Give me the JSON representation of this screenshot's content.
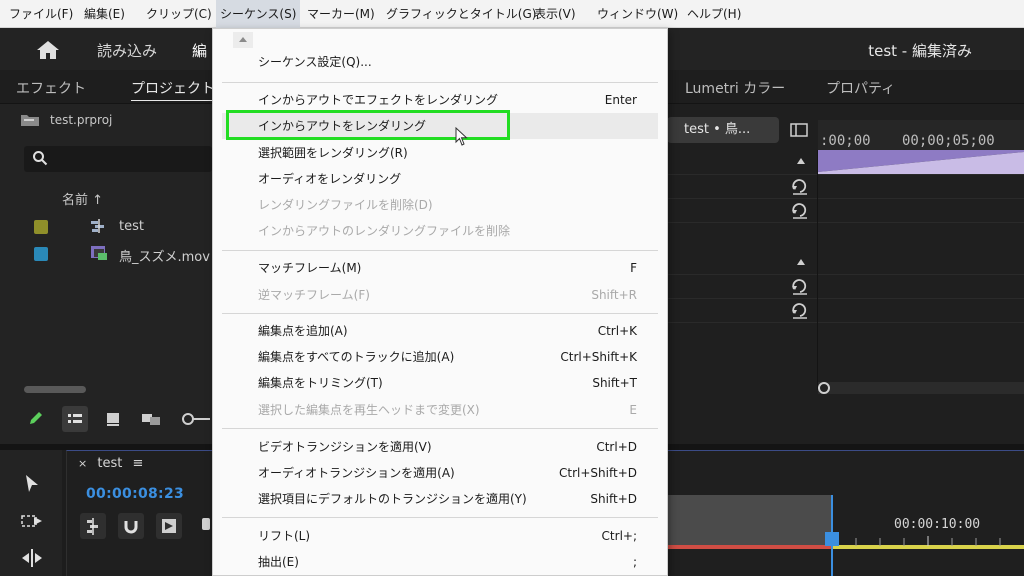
{
  "menubar": {
    "items": [
      "ファイル(F)",
      "編集(E)",
      "クリップ(C)",
      "シーケンス(S)",
      "マーカー(M)",
      "グラフィックとタイトル(G)",
      "表示(V)",
      "ウィンドウ(W)",
      "ヘルプ(H)"
    ],
    "active_index": 3
  },
  "workspace": {
    "tabs": [
      "読み込み",
      "編"
    ],
    "title": "test - 編集済み"
  },
  "panel_tabs": {
    "left": [
      "エフェクト",
      "プロジェクト"
    ],
    "right": [
      "Lumetri カラー",
      "プロパティ"
    ]
  },
  "project": {
    "file_name": "test.prproj",
    "column_name": "名前",
    "items": [
      {
        "label": "test",
        "swatch": "#8f8f2a",
        "icon": "sequence-icon"
      },
      {
        "label": "鳥_スズメ.mov",
        "swatch": "#2a89b8",
        "icon": "clip-icon"
      }
    ]
  },
  "source": {
    "sequence_pill": "test • 鳥...",
    "ruler_labels": [
      ":00;00",
      "00;00;05;00"
    ]
  },
  "timeline": {
    "tab_label": "test",
    "timecode": "00:00:08:23",
    "time_label": "00:00:10:00"
  },
  "menu": {
    "items": [
      {
        "label": "シーケンス設定(Q)...",
        "shortcut": "",
        "disabled": false
      },
      {
        "label": "インからアウトでエフェクトをレンダリング",
        "shortcut": "Enter",
        "disabled": false
      },
      {
        "label": "インからアウトをレンダリング",
        "shortcut": "",
        "disabled": false
      },
      {
        "label": "選択範囲をレンダリング(R)",
        "shortcut": "",
        "disabled": false
      },
      {
        "label": "オーディオをレンダリング",
        "shortcut": "",
        "disabled": false
      },
      {
        "label": "レンダリングファイルを削除(D)",
        "shortcut": "",
        "disabled": true
      },
      {
        "label": "インからアウトのレンダリングファイルを削除",
        "shortcut": "",
        "disabled": true
      },
      {
        "label": "マッチフレーム(M)",
        "shortcut": "F",
        "disabled": false
      },
      {
        "label": "逆マッチフレーム(F)",
        "shortcut": "Shift+R",
        "disabled": true
      },
      {
        "label": "編集点を追加(A)",
        "shortcut": "Ctrl+K",
        "disabled": false
      },
      {
        "label": "編集点をすべてのトラックに追加(A)",
        "shortcut": "Ctrl+Shift+K",
        "disabled": false
      },
      {
        "label": "編集点をトリミング(T)",
        "shortcut": "Shift+T",
        "disabled": false
      },
      {
        "label": "選択した編集点を再生ヘッドまで変更(X)",
        "shortcut": "E",
        "disabled": true
      },
      {
        "label": "ビデオトランジションを適用(V)",
        "shortcut": "Ctrl+D",
        "disabled": false
      },
      {
        "label": "オーディオトランジションを適用(A)",
        "shortcut": "Ctrl+Shift+D",
        "disabled": false
      },
      {
        "label": "選択項目にデフォルトのトランジションを適用(Y)",
        "shortcut": "Shift+D",
        "disabled": false
      },
      {
        "label": "リフト(L)",
        "shortcut": "Ctrl+;",
        "disabled": false
      },
      {
        "label": "抽出(E)",
        "shortcut": ";",
        "disabled": false
      }
    ],
    "highlight_color": "#22dd22"
  }
}
